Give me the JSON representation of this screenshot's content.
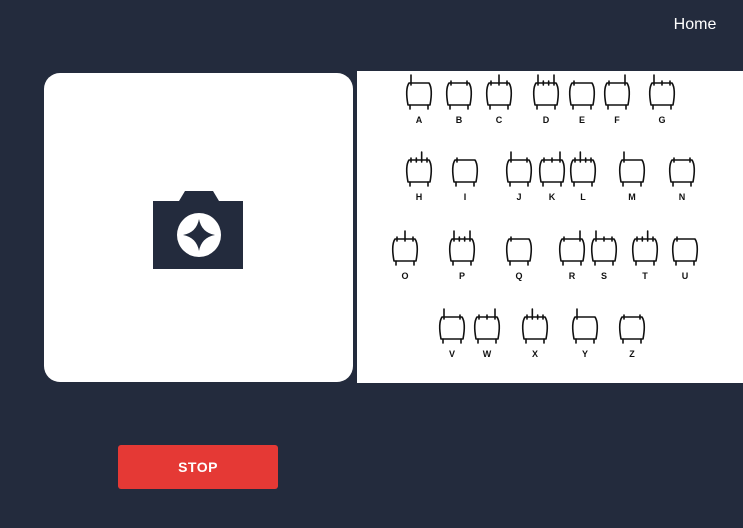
{
  "nav": {
    "home_label": "Home"
  },
  "camera": {
    "icon": "camera-icon"
  },
  "alphabet_chart": {
    "rows": [
      [
        "A",
        "B",
        "C",
        "D",
        "E",
        "F",
        "G"
      ],
      [
        "H",
        "I",
        "J",
        "K",
        "L",
        "M",
        "N"
      ],
      [
        "O",
        "P",
        "Q",
        "R",
        "S",
        "T",
        "U"
      ],
      [
        "V",
        "W",
        "X",
        "Y",
        "Z"
      ]
    ]
  },
  "controls": {
    "stop_label": "STOP"
  },
  "colors": {
    "background": "#232b3d",
    "panel": "#ffffff",
    "stop_button": "#e53935",
    "icon": "#232b3d"
  }
}
